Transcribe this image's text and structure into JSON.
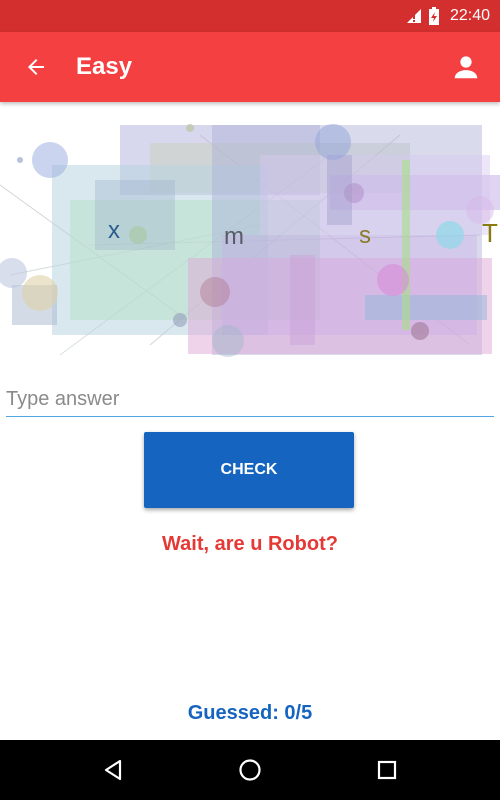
{
  "status_bar": {
    "time": "22:40",
    "icons": [
      "signal-icon",
      "battery-icon"
    ]
  },
  "app_bar": {
    "title": "Easy",
    "back_icon": "arrow-back-icon",
    "account_icon": "account-icon"
  },
  "captcha": {
    "letters": [
      "x",
      "m",
      "s",
      "T"
    ],
    "letter_colors": [
      "#2b5c8f",
      "#5a5a6a",
      "#8a7a2a",
      "#8a7a10"
    ]
  },
  "answer": {
    "placeholder": "Type answer",
    "value": ""
  },
  "check_button": {
    "label": "CHECK"
  },
  "message": "Wait, are u Robot?",
  "guessed": "Guessed: 0/5",
  "nav_bar": {
    "icons": [
      "back-triangle-icon",
      "home-circle-icon",
      "recents-square-icon"
    ]
  },
  "colors": {
    "status_bar": "#d32f2f",
    "app_bar": "#f44040",
    "button": "#1565c0",
    "message": "#e53935",
    "guessed": "#1565c0"
  }
}
